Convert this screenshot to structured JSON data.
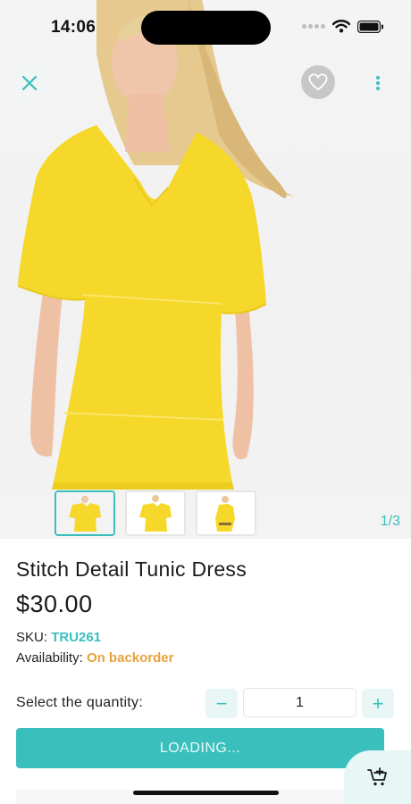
{
  "status_bar": {
    "time": "14:06"
  },
  "gallery": {
    "counter": "1/3",
    "thumbnail_count": 3
  },
  "product": {
    "title": "Stitch Detail Tunic Dress",
    "price": "$30.00",
    "sku_label": "SKU:",
    "sku_value": "TRU261",
    "availability_label": "Availability:",
    "availability_value": "On backorder"
  },
  "quantity": {
    "label": "Select the quantity:",
    "value": "1",
    "minus_symbol": "−",
    "plus_symbol": "+"
  },
  "actions": {
    "add_button_label": "LOADING..."
  },
  "colors": {
    "accent": "#3bbfbd",
    "availability": "#e8a13c",
    "dress": "#f6d82a"
  },
  "icons": [
    "close-icon",
    "heart-icon",
    "more-vertical-icon",
    "cart-add-icon",
    "wifi-icon",
    "battery-icon"
  ]
}
